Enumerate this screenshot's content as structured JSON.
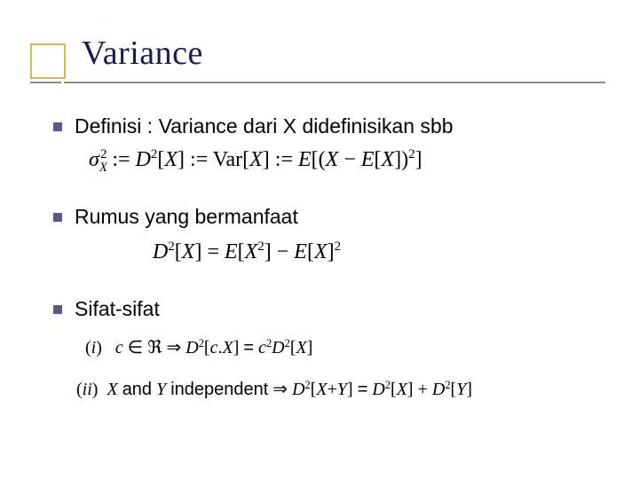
{
  "title": "Variance",
  "bullets": [
    {
      "text": "Definisi : Variance dari X didefinisikan sbb",
      "formula_html": "<span class='i'>σ</span><span class='sub'><span class='i'>X</span></span><span class='sup' style='margin-left:-8px;'>2</span> := <span class='i'>D</span><span class='sup'>2</span>[<span class='i'>X</span>] := Var[<span class='i'>X</span>] := <span class='i'>E</span>[(<span class='i'>X</span> − <span class='i'>E</span>[<span class='i'>X</span>])<span class='sup'>2</span>]"
    },
    {
      "text": "Rumus yang bermanfaat",
      "formula_html": "<span class='i'>D</span><span class='sup'>2</span>[<span class='i'>X</span>] = <span class='i'>E</span>[<span class='i'>X</span><span class='sup'>2</span>] − <span class='i'>E</span>[<span class='i'>X</span>]<span class='sup'>2</span>"
    },
    {
      "text": "Sifat-sifat",
      "formulas_html": [
        "(<span class='i'>i</span>)&nbsp;&nbsp;&nbsp;<span class='i'>c</span> ∈ ℜ ⇒ <span class='i'>D</span><span class='sup'>2</span>[<span class='i'>c</span>.<span class='i'>X</span>] <span class='nonit'>=</span> <span class='i'>c</span><span class='sup'>2</span><span class='i'>D</span><span class='sup'>2</span>[<span class='i'>X</span>]",
        "(<span class='i'>ii</span>)&nbsp;&nbsp;<span class='i'>X</span> <span class='nonit'>and</span> <span class='i'>Y</span> <span class='nonit'>independent</span> ⇒ <span class='i'>D</span><span class='sup'>2</span>[<span class='i'>X</span>+<span class='i'>Y</span>] <span class='nonit'>=</span> <span class='i'>D</span><span class='sup'>2</span>[<span class='i'>X</span>] + <span class='i'>D</span><span class='sup'>2</span>[<span class='i'>Y</span>]"
      ]
    }
  ]
}
